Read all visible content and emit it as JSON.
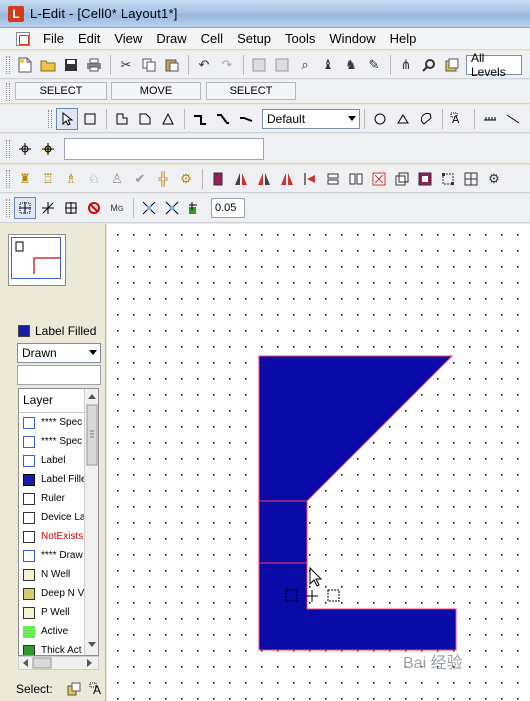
{
  "window": {
    "app_logo": "L",
    "title": "L-Edit - [Cell0*      Layout1*]"
  },
  "menu": {
    "items": [
      "File",
      "Edit",
      "View",
      "Draw",
      "Cell",
      "Setup",
      "Tools",
      "Window",
      "Help"
    ]
  },
  "toolbar1": {
    "layer_filter": "All Levels"
  },
  "mode_row": {
    "left": "SELECT",
    "middle": "MOVE",
    "right": "SELECT"
  },
  "draw_toolbar": {
    "layer_select": "Default"
  },
  "snap_toolbar": {
    "grid_value": "0.05"
  },
  "left_panel": {
    "current_layer": {
      "name": "Label Filled",
      "color": "#1a1aa8"
    },
    "view_mode": "Drawn",
    "layer_header": "Layer",
    "layers": [
      {
        "name": "**** Spec",
        "color": "#ffffff",
        "border": "#3b5bd6",
        "text_color": "#000000"
      },
      {
        "name": "**** Spec",
        "color": "#ffffff",
        "border": "#3b5bd6",
        "text_color": "#000000"
      },
      {
        "name": "Label",
        "color": "#ffffff",
        "border": "#3b5bd6",
        "text_color": "#000000"
      },
      {
        "name": "Label Fille",
        "color": "#1a1aa8",
        "border": "#000000",
        "text_color": "#000000"
      },
      {
        "name": "Ruler",
        "color": "#ffffff",
        "border": "#333333",
        "text_color": "#000000"
      },
      {
        "name": "Device La",
        "color": "#ffffff",
        "border": "#333333",
        "text_color": "#000000"
      },
      {
        "name": "NotExists",
        "color": "#ffffff",
        "border": "#333333",
        "text_color": "#cc0000"
      },
      {
        "name": "**** Draw",
        "color": "#ffffff",
        "border": "#3b5bd6",
        "text_color": "#000000"
      },
      {
        "name": "N Well",
        "color": "#f4f0d0",
        "border": "#333333",
        "text_color": "#000000"
      },
      {
        "name": "Deep N V",
        "color": "#d8cc70",
        "border": "#333333",
        "text_color": "#000000"
      },
      {
        "name": "P Well",
        "color": "#f4f0d0",
        "border": "#333333",
        "text_color": "#000000"
      },
      {
        "name": "Active",
        "color": "#66ee55",
        "border": "#66ee55",
        "text_color": "#000000"
      },
      {
        "name": "Thick Act",
        "color": "#2f9a2f",
        "border": "#333333",
        "text_color": "#000000"
      }
    ],
    "select_label": "Select:"
  },
  "canvas": {
    "shape_fill": "#0a0aa6",
    "shape_edge": "#ff3b6b",
    "dot_color": "#000000"
  },
  "watermark": "Bai 经验"
}
